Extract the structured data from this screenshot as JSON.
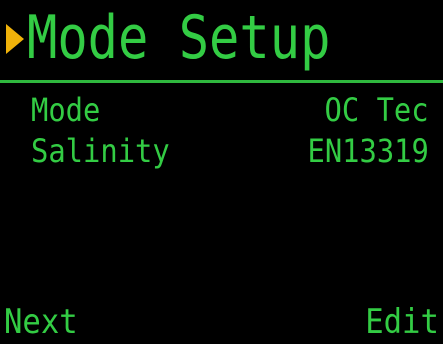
{
  "header": {
    "cursor_icon": "selection-arrow-icon",
    "title": "Mode Setup"
  },
  "settings": [
    {
      "label": "Mode",
      "value": "OC Tec"
    },
    {
      "label": "Salinity",
      "value": "EN13319"
    }
  ],
  "softkeys": {
    "left": "Next",
    "right": "Edit"
  },
  "colors": {
    "text": "#33cc44",
    "cursor": "#f0b20a",
    "background": "#000000"
  }
}
